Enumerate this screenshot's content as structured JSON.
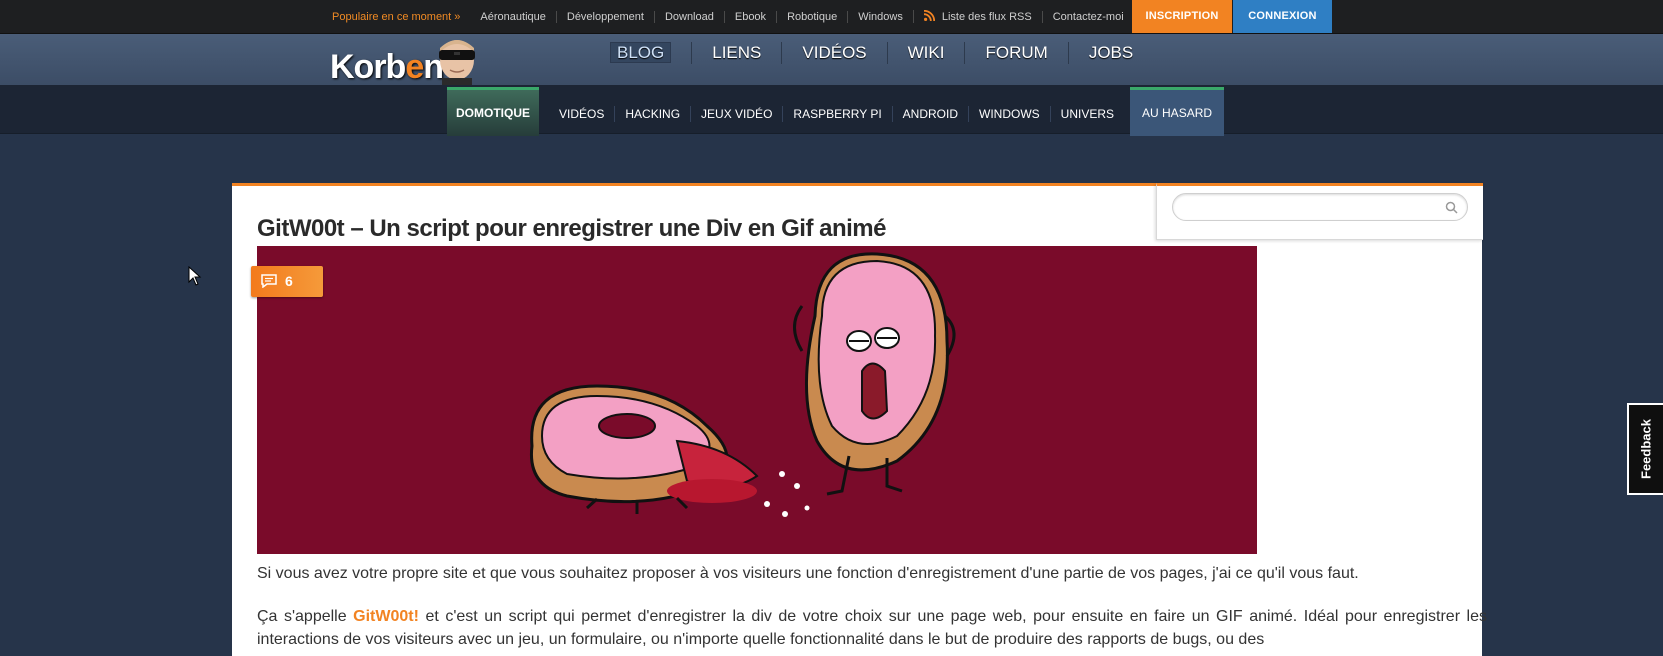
{
  "topbar": {
    "popular_label": "Populaire en ce moment »",
    "links": [
      "Aéronautique",
      "Développement",
      "Download",
      "Ebook",
      "Robotique",
      "Windows"
    ],
    "rss_label": "Liste des flux RSS",
    "contact_label": "Contactez-moi",
    "inscription_label": "INSCRIPTION",
    "connexion_label": "CONNEXION"
  },
  "logo": {
    "text_main": "Korb",
    "text_accent": "e",
    "text_end": "n"
  },
  "mainnav": [
    "BLOG",
    "LIENS",
    "VIDÉOS",
    "WIKI",
    "FORUM",
    "JOBS"
  ],
  "catnav": {
    "featured": "DOMOTIQUE",
    "items": [
      "VIDÉOS",
      "HACKING",
      "JEUX VIDÉO",
      "RASPBERRY PI",
      "ANDROID",
      "WINDOWS",
      "UNIVERS"
    ],
    "random": "AU HASARD"
  },
  "search": {
    "placeholder": ""
  },
  "article": {
    "title": "GitW00t – Un script pour enregistrer une Div en Gif animé",
    "comment_count": "6",
    "para1": "Si vous avez votre propre site et que vous souhaitez proposer à vos visiteurs une fonction d'enregistrement d'une partie de vos pages, j'ai ce qu'il vous faut.",
    "para2_before": "Ça s'appelle ",
    "para2_link": "GitW00t!",
    "para2_after": " et c'est un script qui permet d'enregistrer la div de votre choix sur une page web, pour ensuite en faire un GIF animé. Idéal pour enregistrer les interactions de vos visiteurs avec un jeu, un formulaire, ou n'importe quelle fonctionnalité dans le but de produire des rapports de bugs, ou des"
  },
  "feedback_label": "Feedback",
  "colors": {
    "accent": "#f28322",
    "hero_bg": "#7a0b2a",
    "blue": "#2f7fc4"
  }
}
